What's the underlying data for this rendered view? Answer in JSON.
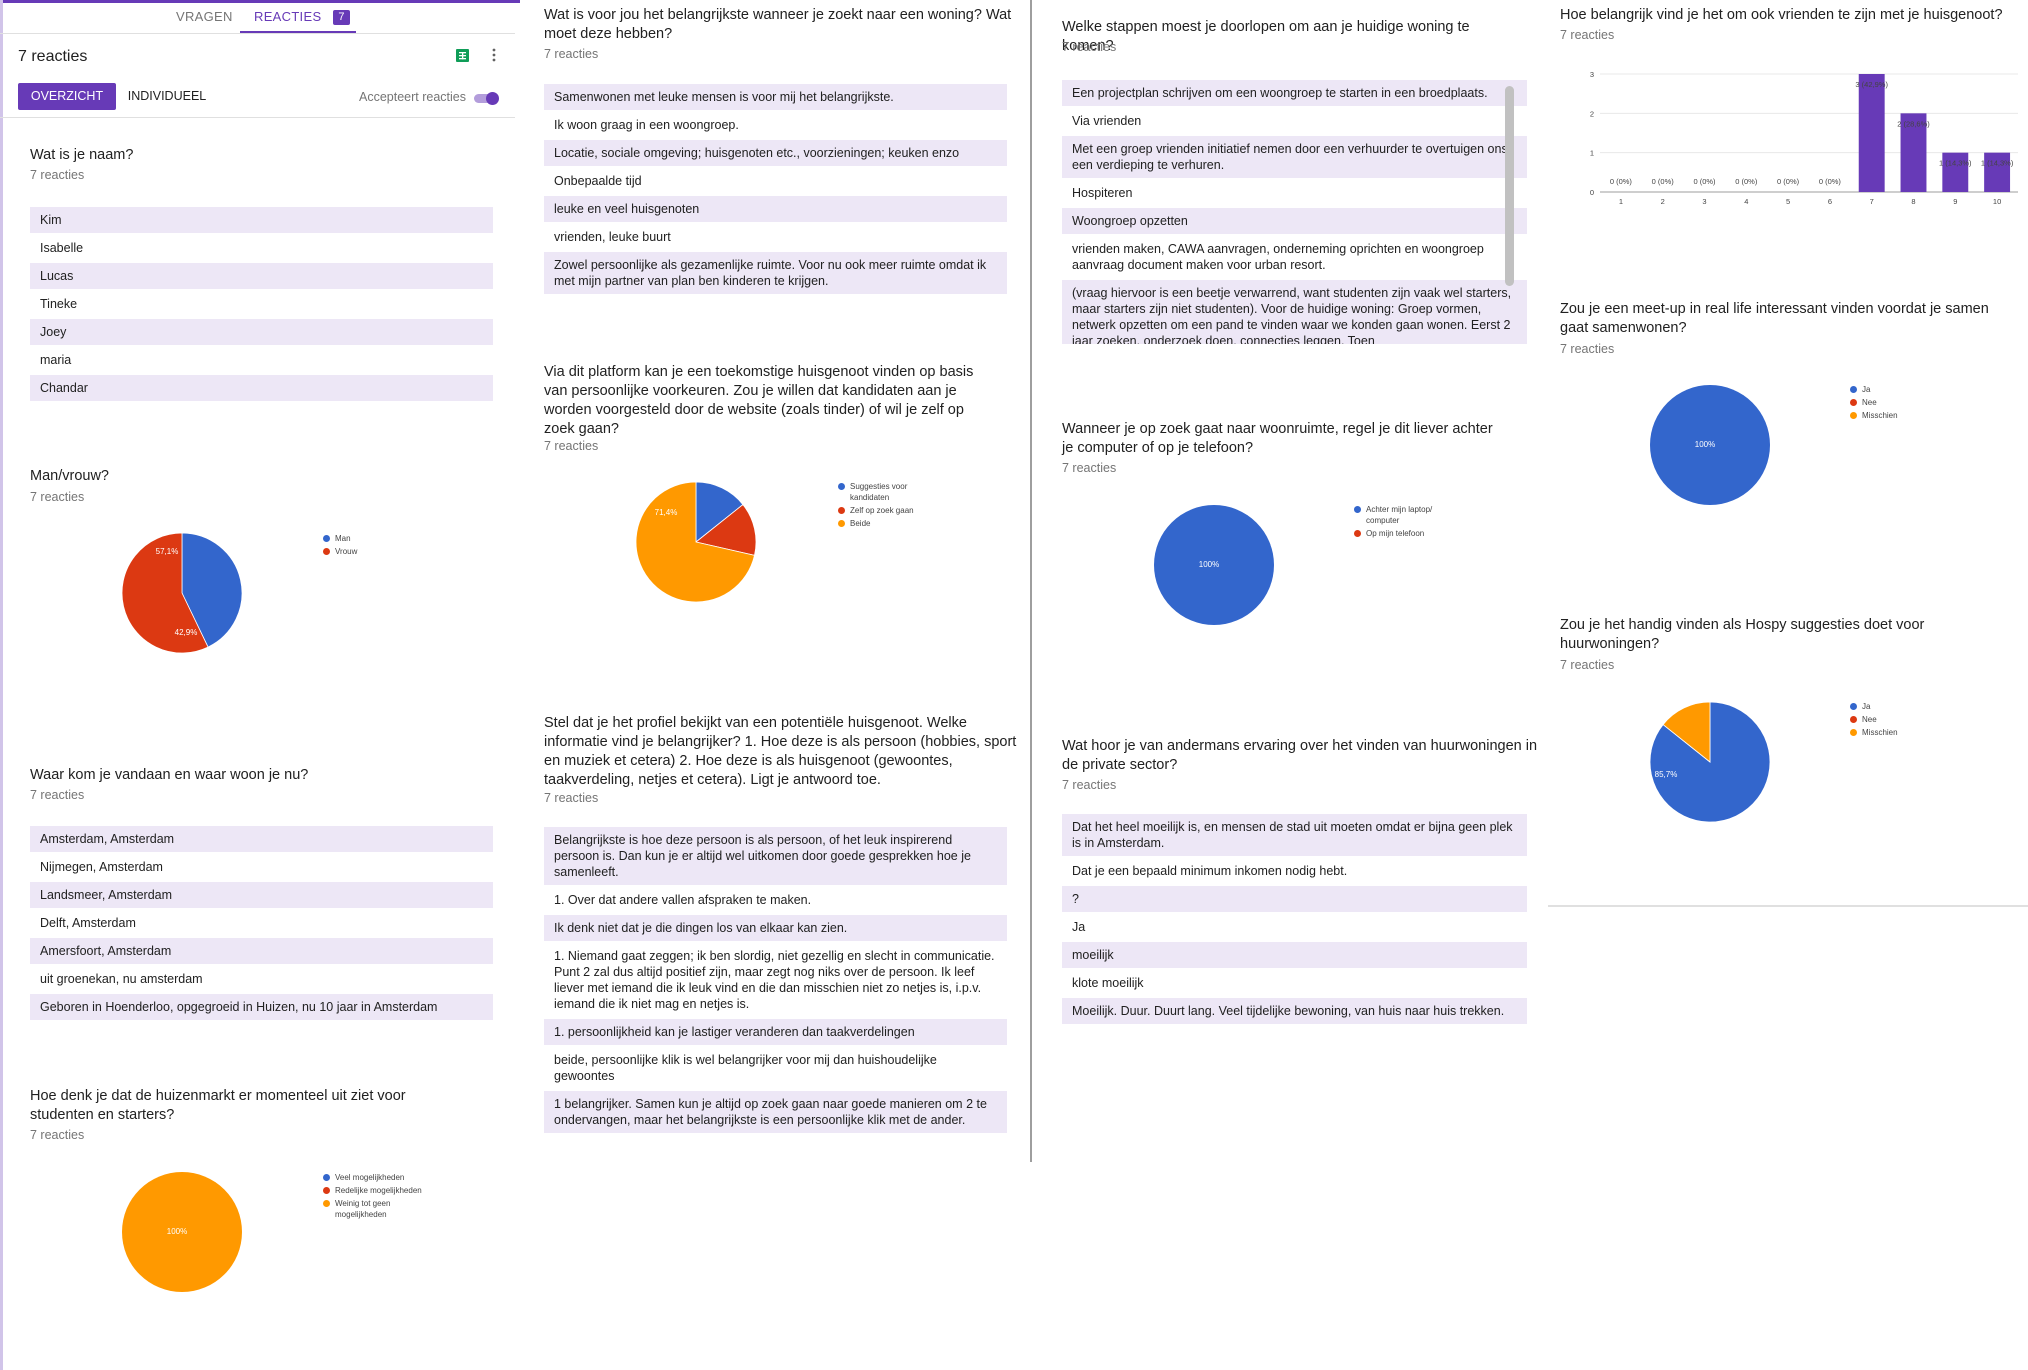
{
  "header": {
    "tab_questions": "VRAGEN",
    "tab_responses": "REACTIES",
    "tab_responses_badge": "7",
    "title": "7 reacties",
    "btn_summary": "OVERZICHT",
    "btn_individual": "INDIVIDUEEL",
    "accepting_label": "Accepteert reacties",
    "accepting_on": true
  },
  "colors": {
    "accent": "#673ab7",
    "blue": "#3366cc",
    "red": "#dc3912",
    "orange": "#ff9900",
    "sheets_green": "#0f9d58"
  },
  "q_name": {
    "title": "Wat is je naam?",
    "count": "7 reacties",
    "answers": [
      "Kim",
      "Isabelle",
      "Lucas",
      "Tineke",
      "Joey",
      "maria",
      "Chandar"
    ]
  },
  "q_gender": {
    "title": "Man/vrouw?",
    "count": "7 reacties",
    "legend": [
      "Man",
      "Vrouw"
    ],
    "labels": [
      "42,9%",
      "57,1%"
    ]
  },
  "q_origin": {
    "title": "Waar kom je vandaan en waar woon je nu?",
    "count": "7 reacties",
    "answers": [
      "Amsterdam, Amsterdam",
      "Nijmegen, Amsterdam",
      "Landsmeer, Amsterdam",
      "Delft, Amsterdam",
      "Amersfoort, Amsterdam",
      "uit groenekan, nu amsterdam",
      "Geboren in Hoenderloo, opgegroeid in Huizen, nu 10 jaar in Amsterdam"
    ]
  },
  "q_market": {
    "title": "Hoe denk je dat de huizenmarkt er momenteel uit ziet voor studenten en starters?",
    "count": "7 reacties",
    "legend": [
      "Veel mogelijkheden",
      "Redelijke mogelijkheden",
      "Weinig tot geen mogelijkheden"
    ],
    "labels": [
      "100%"
    ]
  },
  "q_important": {
    "title": "Wat is voor jou het belangrijkste wanneer je zoekt naar een woning? Wat moet deze hebben?",
    "count": "7 reacties",
    "answers": [
      "Samenwonen met leuke mensen is voor mij het belangrijkste.",
      "Ik woon graag in een woongroep.",
      "Locatie, sociale omgeving; huisgenoten etc., voorzieningen; keuken enzo",
      "Onbepaalde tijd",
      "leuke en veel huisgenoten",
      "vrienden, leuke buurt",
      "Zowel persoonlijke als gezamenlijke ruimte. Voor nu ook meer ruimte omdat ik met mijn partner van plan ben kinderen te krijgen."
    ]
  },
  "q_platform": {
    "title": "Via dit platform kan je een toekomstige huisgenoot vinden op basis van persoonlijke voorkeuren. Zou je willen dat kandidaten aan je worden voorgesteld door de website (zoals tinder) of wil je zelf op zoek gaan?",
    "count": "7 reacties",
    "legend": [
      "Suggesties voor kandidaten",
      "Zelf op zoek gaan",
      "Beide"
    ],
    "labels": [
      "71,4%"
    ]
  },
  "q_profile": {
    "title": "Stel dat je het profiel bekijkt van een potentiële huisgenoot. Welke informatie vind je belangrijker? 1. Hoe deze is als persoon (hobbies, sport en muziek et cetera) 2. Hoe deze is als huisgenoot (gewoontes, taakverdeling, netjes et cetera). Ligt je antwoord toe.",
    "count": "7 reacties",
    "answers": [
      "Belangrijkste is hoe deze persoon is als persoon, of het leuk inspirerend persoon is. Dan kun je er altijd wel uitkomen door goede gesprekken hoe je samenleeft.",
      "1. Over dat andere vallen afspraken te maken.",
      "Ik denk niet dat je die dingen los van elkaar kan zien.",
      "1. Niemand gaat zeggen; ik ben slordig, niet gezellig en slecht in communicatie. Punt 2 zal dus altijd positief zijn, maar zegt nog niks over de persoon. Ik leef liever met iemand die ik leuk vind en die dan misschien niet zo netjes is, i.p.v. iemand die ik niet mag en netjes is.",
      "1. persoonlijkheid kan je lastiger veranderen dan taakverdelingen",
      "beide, persoonlijke klik is wel belangrijker voor mij dan huishoudelijke gewoontes",
      "1 belangrijker. Samen kun je altijd op zoek gaan naar goede manieren om 2 te ondervangen, maar het belangrijkste is een persoonlijke klik met de ander."
    ]
  },
  "q_steps": {
    "title": "Welke stappen moest je doorlopen om aan je huidige woning te komen?",
    "count": "7 reacties",
    "answers": [
      "Een projectplan schrijven om een woongroep te starten in een broedplaats.",
      "Via vrienden",
      "Met een groep vrienden initiatief nemen door een verhuurder te overtuigen ons een verdieping te verhuren.",
      "Hospiteren",
      "Woongroep opzetten",
      "vrienden maken, CAWA aanvragen, onderneming oprichten en woongroep aanvraag document maken voor urban resort.",
      "(vraag hiervoor is een beetje verwarrend, want studenten zijn vaak wel starters, maar starters zijn niet studenten). Voor de huidige woning: Groep vormen, netwerk opzetten om een pand te vinden waar we konden gaan wonen. Eerst 2 jaar zoeken, onderzoek doen, connecties leggen. Toen"
    ]
  },
  "q_device": {
    "title": "Wanneer je op zoek gaat naar woonruimte, regel je dit liever achter je computer of op je telefoon?",
    "count": "7 reacties",
    "legend": [
      "Achter mijn laptop/ computer",
      "Op mijn telefoon"
    ],
    "labels": [
      "100%"
    ]
  },
  "q_hear": {
    "title": "Wat hoor je van andermans ervaring over het vinden van huurwoningen in de private sector?",
    "count": "7 reacties",
    "answers": [
      "Dat het heel moeilijk is, en mensen de stad uit moeten omdat er bijna geen plek is in Amsterdam.",
      "Dat je een bepaald minimum inkomen nodig hebt.",
      "?",
      "Ja",
      "moeilijk",
      "klote moeilijk",
      "Moeilijk. Duur. Duurt lang. Veel tijdelijke bewoning, van huis naar huis trekken."
    ]
  },
  "q_friends": {
    "title": "Hoe belangrijk vind je het om ook vrienden te zijn met je huisgenoot?",
    "count": "7 reacties"
  },
  "chart_data": [
    {
      "type": "bar",
      "categories": [
        "1",
        "2",
        "3",
        "4",
        "5",
        "6",
        "7",
        "8",
        "9",
        "10"
      ],
      "values": [
        0,
        0,
        0,
        0,
        0,
        0,
        3,
        2,
        1,
        1
      ],
      "data_labels": [
        "0 (0%)",
        "0 (0%)",
        "0 (0%)",
        "0 (0%)",
        "0 (0%)",
        "0 (0%)",
        "3 (42,9%)",
        "2 (28,6%)",
        "1 (14,3%)",
        "1 (14,3%)"
      ],
      "ylim": [
        0,
        3
      ],
      "yticks": [
        "0",
        "1",
        "2",
        "3"
      ],
      "grid": true,
      "color": "#673ab7"
    }
  ],
  "q_meetup": {
    "title": "Zou je een meet-up in real life interessant vinden voordat je samen gaat samenwonen?",
    "count": "7 reacties",
    "legend": [
      "Ja",
      "Nee",
      "Misschien"
    ],
    "labels": [
      "100%"
    ]
  },
  "q_suggest": {
    "title": "Zou je het handig vinden als Hospy suggesties doet voor huurwoningen?",
    "count": "7 reacties",
    "legend": [
      "Ja",
      "Nee",
      "Misschien"
    ],
    "labels": [
      "85,7%"
    ]
  },
  "pies": {
    "gender": [
      {
        "value": 3,
        "color": "#3366cc"
      },
      {
        "value": 4,
        "color": "#dc3912"
      }
    ],
    "market": [
      {
        "value": 0,
        "color": "#3366cc"
      },
      {
        "value": 0,
        "color": "#dc3912"
      },
      {
        "value": 7,
        "color": "#ff9900"
      }
    ],
    "platform": [
      {
        "value": 1,
        "color": "#3366cc"
      },
      {
        "value": 1,
        "color": "#dc3912"
      },
      {
        "value": 5,
        "color": "#ff9900"
      }
    ],
    "device": [
      {
        "value": 7,
        "color": "#3366cc"
      },
      {
        "value": 0,
        "color": "#dc3912"
      }
    ],
    "meetup": [
      {
        "value": 7,
        "color": "#3366cc"
      },
      {
        "value": 0,
        "color": "#dc3912"
      },
      {
        "value": 0,
        "color": "#ff9900"
      }
    ],
    "suggest": [
      {
        "value": 6,
        "color": "#3366cc"
      },
      {
        "value": 0,
        "color": "#dc3912"
      },
      {
        "value": 1,
        "color": "#ff9900"
      }
    ]
  }
}
